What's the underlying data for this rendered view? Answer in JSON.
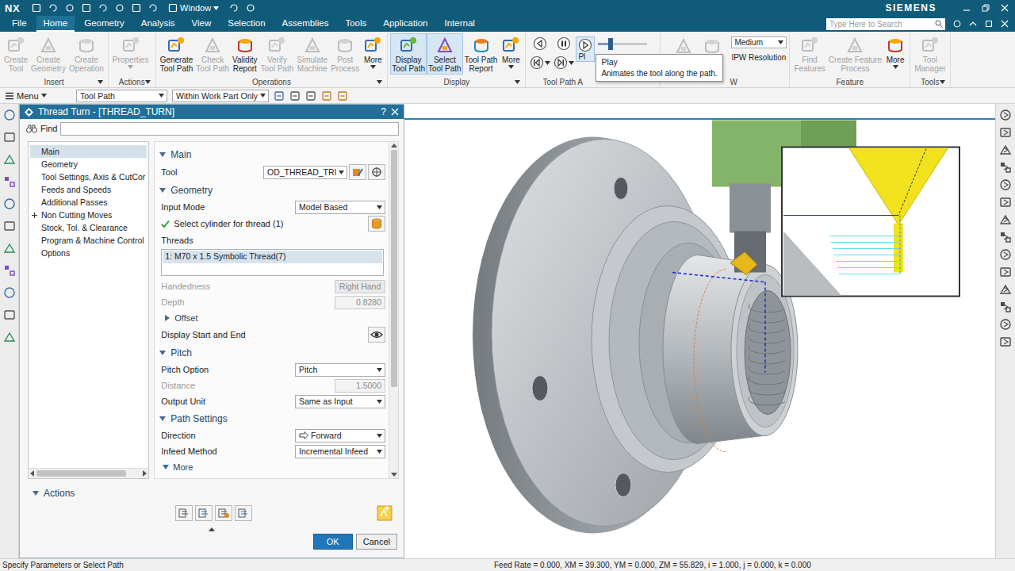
{
  "title_bar": {
    "logo": "NX",
    "window_menu": "Window",
    "brand": "SIEMENS",
    "search_placeholder": "Type Here to Search"
  },
  "menu_tabs": [
    {
      "label": "File",
      "selected": false
    },
    {
      "label": "Home",
      "selected": true
    },
    {
      "label": "Geometry",
      "selected": false
    },
    {
      "label": "Analysis",
      "selected": false
    },
    {
      "label": "View",
      "selected": false
    },
    {
      "label": "Selection",
      "selected": false
    },
    {
      "label": "Assemblies",
      "selected": false
    },
    {
      "label": "Tools",
      "selected": false
    },
    {
      "label": "Application",
      "selected": false
    },
    {
      "label": "Internal",
      "selected": false
    }
  ],
  "ribbon": {
    "groups": [
      {
        "kind": "buttons",
        "label": "Insert",
        "menu": true,
        "items": [
          {
            "lines": [
              "Create",
              "Tool"
            ],
            "disabled": true,
            "selected": false,
            "dropdown": false
          },
          {
            "lines": [
              "Create",
              "Geometry"
            ],
            "disabled": true,
            "selected": false,
            "dropdown": false
          },
          {
            "lines": [
              "Create",
              "Operation"
            ],
            "disabled": true,
            "selected": false,
            "dropdown": false
          }
        ]
      },
      {
        "kind": "buttons",
        "label": "Actions",
        "menu": true,
        "items": [
          {
            "lines": [
              "Properties"
            ],
            "disabled": true,
            "selected": false,
            "dropdown": true
          }
        ]
      },
      {
        "kind": "buttons",
        "label": "Operations",
        "menu": true,
        "items": [
          {
            "lines": [
              "Generate",
              "Tool Path"
            ],
            "disabled": false,
            "selected": false,
            "dropdown": false
          },
          {
            "lines": [
              "Check",
              "Tool Path"
            ],
            "disabled": true,
            "selected": false,
            "dropdown": false
          },
          {
            "lines": [
              "Validity",
              "Report"
            ],
            "disabled": false,
            "selected": false,
            "dropdown": false
          },
          {
            "lines": [
              "Verify",
              "Tool Path"
            ],
            "disabled": true,
            "selected": false,
            "dropdown": false
          },
          {
            "lines": [
              "Simulate",
              "Machine"
            ],
            "disabled": true,
            "selected": false,
            "dropdown": false
          },
          {
            "lines": [
              "Post",
              "Process"
            ],
            "disabled": true,
            "selected": false,
            "dropdown": false
          },
          {
            "lines": [
              "More"
            ],
            "disabled": false,
            "selected": false,
            "dropdown": true
          }
        ]
      },
      {
        "kind": "buttons",
        "label": "Display",
        "menu": true,
        "items": [
          {
            "lines": [
              "Display",
              "Tool Path"
            ],
            "disabled": false,
            "selected": true,
            "dropdown": false
          },
          {
            "lines": [
              "Select",
              "Tool Path"
            ],
            "disabled": false,
            "selected": true,
            "dropdown": false
          },
          {
            "lines": [
              "Tool Path",
              "Report"
            ],
            "disabled": false,
            "selected": false,
            "dropdown": false
          },
          {
            "lines": [
              "More"
            ],
            "disabled": false,
            "selected": false,
            "dropdown": true
          }
        ]
      },
      {
        "kind": "animation",
        "label": "Tool Path A",
        "play_label": "Pl",
        "play_highlighted": true,
        "level": 0.25
      },
      {
        "kind": "ipw",
        "label": "W",
        "resolution": "Medium",
        "resolution_label": "IPW Resolution"
      },
      {
        "kind": "buttons",
        "label": "Feature",
        "menu": false,
        "items": [
          {
            "lines": [
              "Find",
              "Features"
            ],
            "disabled": true,
            "selected": false,
            "dropdown": false
          },
          {
            "lines": [
              "Create Feature",
              "Process"
            ],
            "disabled": true,
            "selected": false,
            "dropdown": false
          },
          {
            "lines": [
              "More"
            ],
            "disabled": false,
            "selected": false,
            "dropdown": true
          }
        ]
      },
      {
        "kind": "buttons",
        "label": "Tools",
        "menu": true,
        "items": [
          {
            "lines": [
              "Tool",
              "Manager"
            ],
            "disabled": true,
            "selected": false,
            "dropdown": false
          }
        ]
      }
    ]
  },
  "tooltip": {
    "title": "Play",
    "text": "Animates the tool along the path."
  },
  "toolbar": {
    "menu": "Menu",
    "filter": "Tool Path",
    "scope": "Within Work Part Only"
  },
  "dialog": {
    "title": "Thread Turn - [THREAD_TURN]",
    "help": "?",
    "find_label": "Find",
    "find_value": "",
    "nav": [
      {
        "label": "Main",
        "selected": true,
        "expandable": false
      },
      {
        "label": "Geometry",
        "selected": false,
        "expandable": false
      },
      {
        "label": "Tool Settings, Axis & CutCor",
        "selected": false,
        "expandable": false
      },
      {
        "label": "Feeds and Speeds",
        "selected": false,
        "expandable": false
      },
      {
        "label": "Additional Passes",
        "selected": false,
        "expandable": false
      },
      {
        "label": "Non Cutting Moves",
        "selected": false,
        "expandable": true
      },
      {
        "label": "Stock, Tol. & Clearance",
        "selected": false,
        "expandable": false
      },
      {
        "label": "Program & Machine Control",
        "selected": false,
        "expandable": false
      },
      {
        "label": "Options",
        "selected": false,
        "expandable": false
      }
    ],
    "nav_scroll_level": 0.86,
    "content_scroll_level": 0.74,
    "sections": [
      {
        "title": "Main",
        "expanded": true,
        "rows": [
          {
            "kind": "tool",
            "label": "Tool",
            "value": "OD_THREAD_TRI",
            "disabled": false
          }
        ]
      },
      {
        "title": "Geometry",
        "expanded": true,
        "rows": [
          {
            "kind": "dropdown",
            "label": "Input Mode",
            "value": "Model Based",
            "disabled": false
          },
          {
            "kind": "check",
            "label": "Select cylinder for thread (1)",
            "checked": true
          },
          {
            "kind": "caption",
            "label": "Threads"
          },
          {
            "kind": "list",
            "items": [
              {
                "label": "1: M70 x 1.5 Symbolic Thread(7)",
                "selected": true
              }
            ]
          },
          {
            "kind": "choice",
            "label": "Handedness",
            "value": "Right Hand",
            "disabled": true
          },
          {
            "kind": "field",
            "label": "Depth",
            "value": "0.8280",
            "disabled": true
          },
          {
            "kind": "group",
            "label": "Offset",
            "expanded": false
          },
          {
            "kind": "eye",
            "label": "Display Start and End",
            "on": true
          }
        ]
      },
      {
        "title": "Pitch",
        "expanded": true,
        "rows": [
          {
            "kind": "dropdown",
            "label": "Pitch Option",
            "value": "Pitch",
            "disabled": false
          },
          {
            "kind": "field",
            "label": "Distance",
            "value": "1.5000",
            "disabled": true
          },
          {
            "kind": "dropdown",
            "label": "Output Unit",
            "value": "Same as Input",
            "disabled": false
          }
        ]
      },
      {
        "title": "Path Settings",
        "expanded": true,
        "rows": [
          {
            "kind": "direction",
            "label": "Direction",
            "value": "Forward",
            "disabled": false
          },
          {
            "kind": "dropdown",
            "label": "Infeed Method",
            "value": "Incremental Infeed",
            "disabled": false
          },
          {
            "kind": "more",
            "label": "More",
            "expanded": false
          }
        ]
      }
    ],
    "actions": {
      "title": "Actions",
      "expanded": true
    },
    "buttons": [
      {
        "label": "OK",
        "primary": true
      },
      {
        "label": "Cancel",
        "primary": false
      }
    ]
  },
  "status_bar": {
    "prompt": "Specify Parameters or Select Path",
    "readout": "Feed Rate = 0.000, XM = 39.300, YM = 0.000, ZM = 55.829, i = 1.000, j = 0.000, k = 0.000"
  }
}
